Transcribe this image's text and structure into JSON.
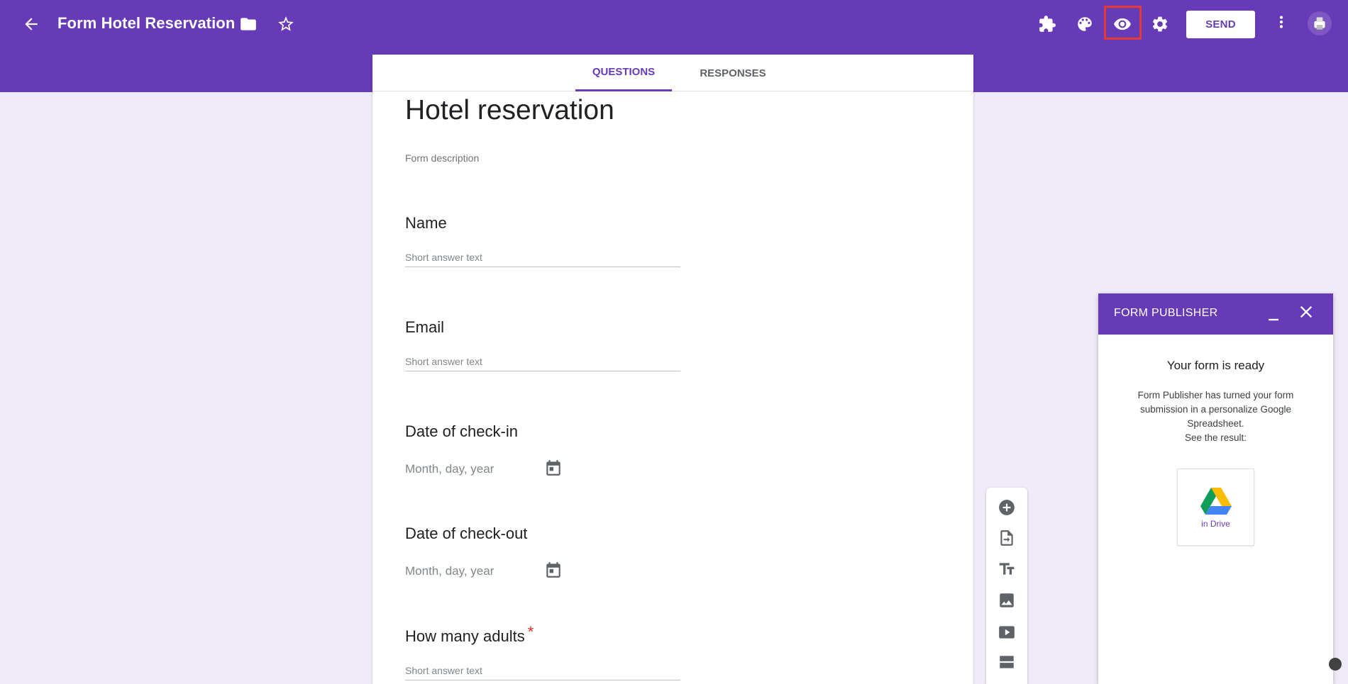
{
  "header": {
    "form_title": "Form Hotel Reservation",
    "send_label": "SEND",
    "color": "#673ab7"
  },
  "tabs": [
    {
      "label": "QUESTIONS",
      "active": true
    },
    {
      "label": "RESPONSES",
      "active": false
    }
  ],
  "form": {
    "title": "Hotel reservation",
    "description": "Form description",
    "questions": [
      {
        "title": "Name",
        "type": "short",
        "placeholder": "Short answer text",
        "required": false
      },
      {
        "title": "Email",
        "type": "short",
        "placeholder": "Short answer text",
        "required": false
      },
      {
        "title": "Date of check-in",
        "type": "date",
        "placeholder": "Month, day, year",
        "required": false
      },
      {
        "title": "Date of check-out",
        "type": "date",
        "placeholder": "Month, day, year",
        "required": false
      },
      {
        "title": "How many adults",
        "type": "short",
        "placeholder": "Short answer text",
        "required": true,
        "required_mark": "*"
      }
    ]
  },
  "toolbar": {
    "icons": [
      "add-question-icon",
      "import-questions-icon",
      "add-title-icon",
      "add-image-icon",
      "add-video-icon",
      "add-section-icon"
    ]
  },
  "publisher": {
    "title": "FORM PUBLISHER",
    "heading": "Your form is ready",
    "text_lines": [
      "Form Publisher has turned your form",
      "submission in a personalize Google",
      "Spreadsheet.",
      "See the result:"
    ],
    "drive_label": "in Drive"
  },
  "icons": {
    "back": "arrow-back-icon",
    "folder": "folder-icon",
    "star": "star-outline-icon",
    "addons": "puzzle-icon",
    "palette": "palette-icon",
    "preview": "eye-icon",
    "settings": "gear-icon",
    "more": "more-vert-icon",
    "calendar": "calendar-icon"
  }
}
